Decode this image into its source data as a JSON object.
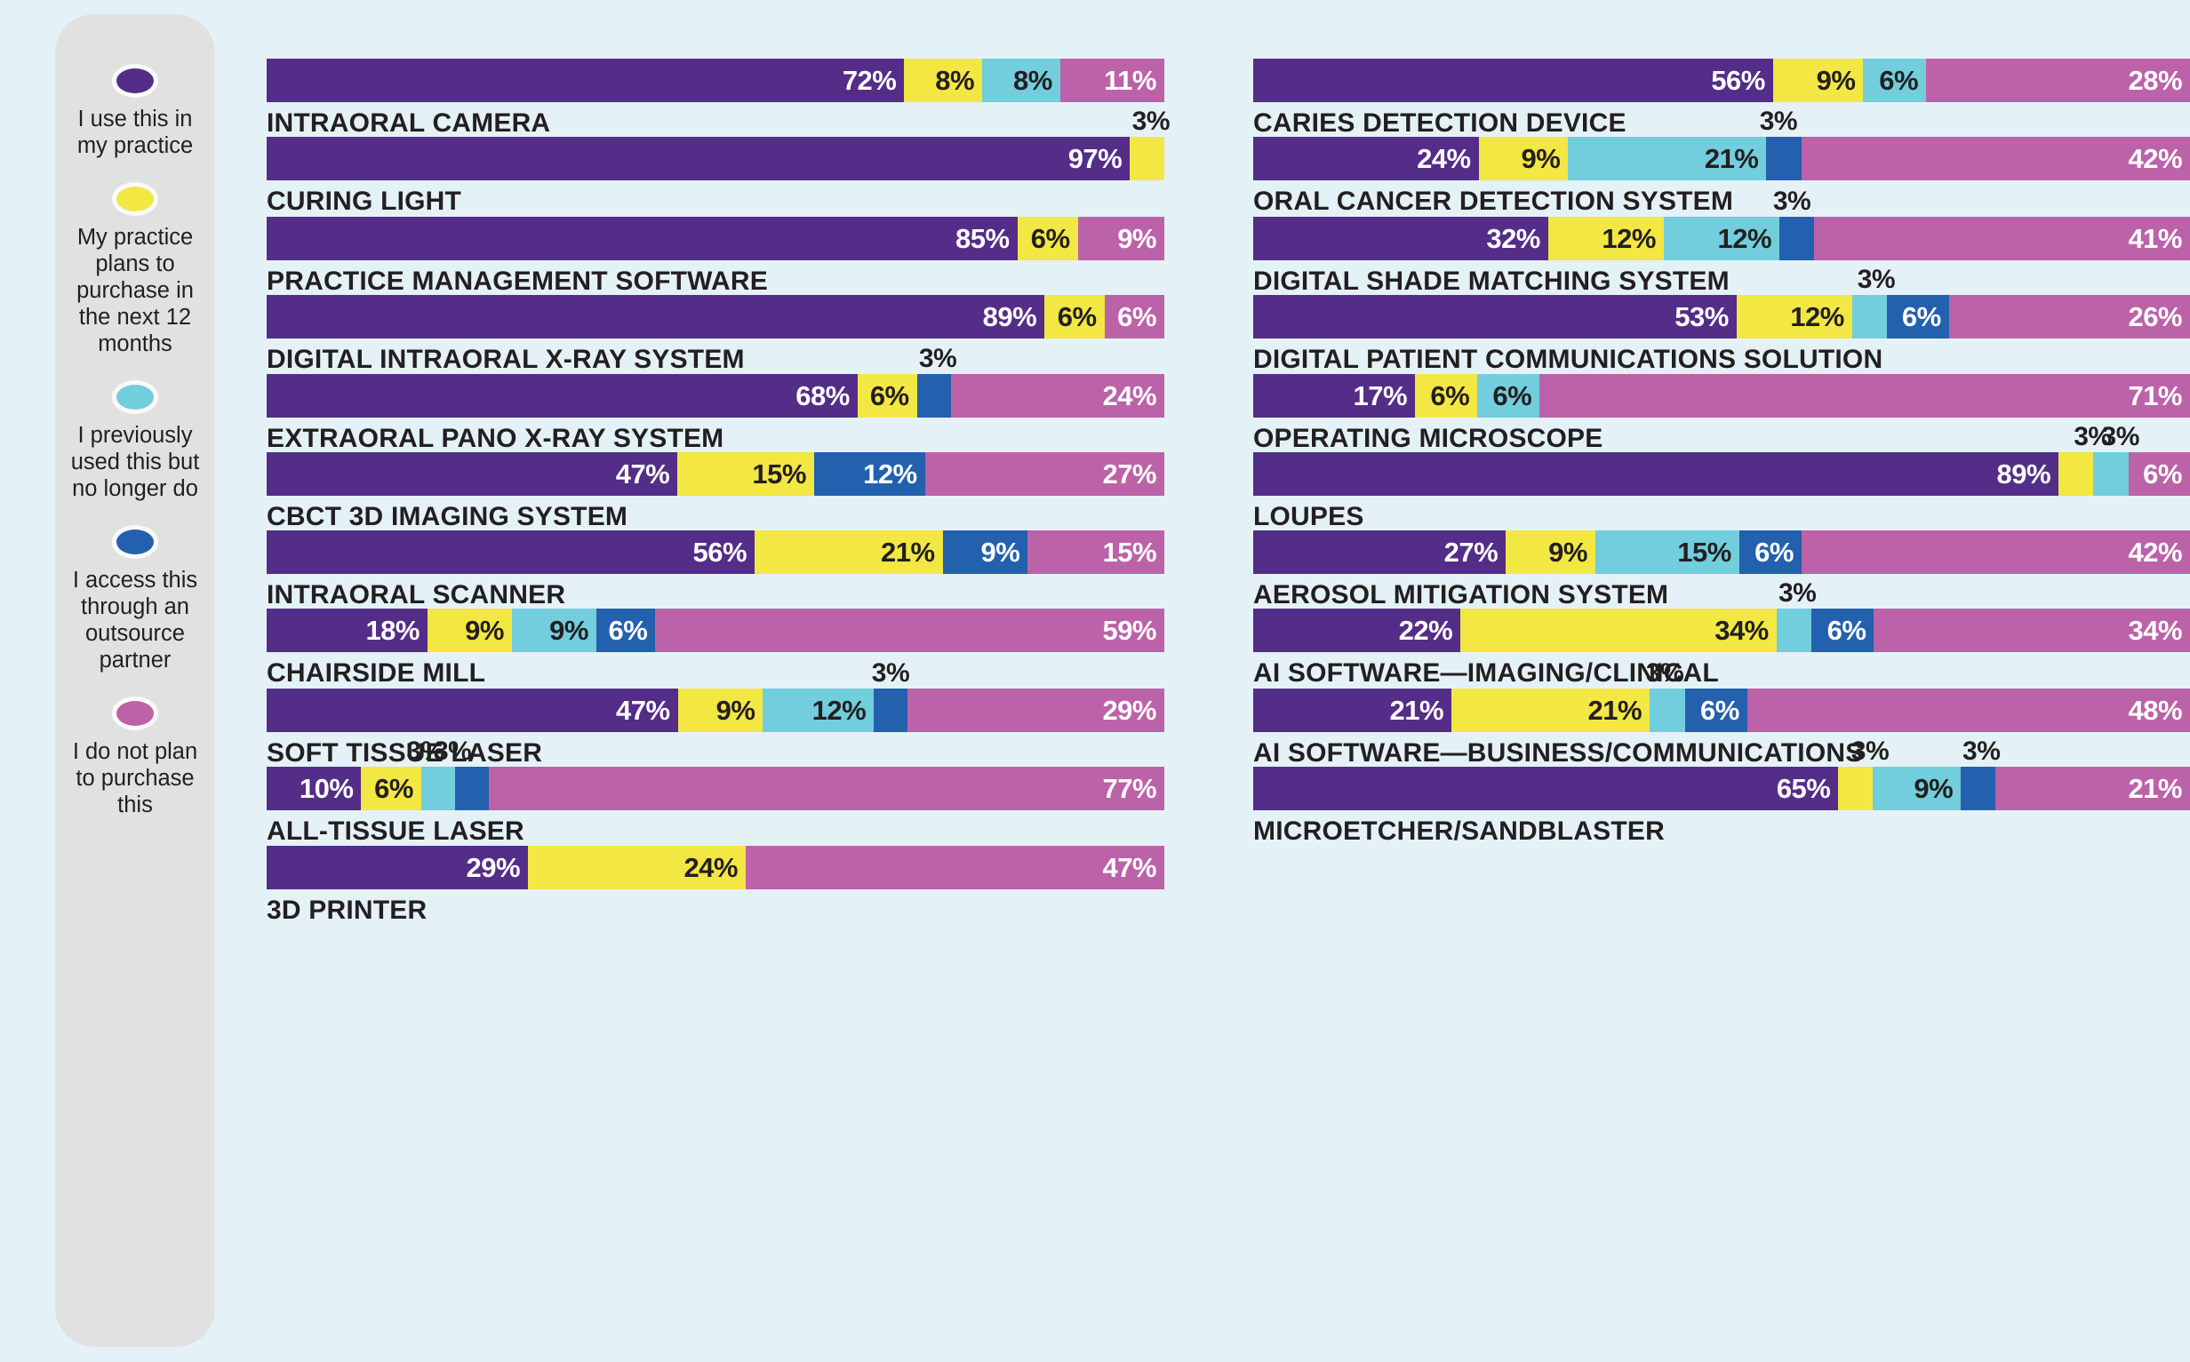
{
  "background_color": "#e4f2f7",
  "legend": {
    "panel_color": "#e2e1e1",
    "items": [
      {
        "color": "#532d87",
        "label": "I use this in my practice"
      },
      {
        "color": "#f3e743",
        "label": "My practice plans to purchase in the next 12 months"
      },
      {
        "color": "#72cddc",
        "label": "I previously used this but no longer do"
      },
      {
        "color": "#2360ae",
        "label": "I access this through an outsource partner"
      },
      {
        "color": "#bc62a8",
        "label": "I do not plan to purchase this"
      }
    ]
  },
  "chart_data": {
    "type": "bar",
    "title": "",
    "xlabel": "",
    "ylabel": "",
    "orientation": "horizontal",
    "stacked": true,
    "normalized_percent": true,
    "xlim": [
      0,
      100
    ],
    "grid": false,
    "legend_position": "left",
    "series": [
      {
        "name": "I use this in my practice",
        "color": "#532d87"
      },
      {
        "name": "My practice plans to purchase in the next 12 months",
        "color": "#f3e743"
      },
      {
        "name": "I previously used this but no longer do",
        "color": "#72cddc"
      },
      {
        "name": "I access this through an outsource partner",
        "color": "#2360ae"
      },
      {
        "name": "I do not plan to purchase this",
        "color": "#bc62a8"
      }
    ],
    "columns": [
      {
        "id": "left",
        "categories": [
          {
            "label": "INTRAORAL CAMERA",
            "segments": [
              {
                "series": 0,
                "value": 72,
                "label": "72%",
                "inside": true
              },
              {
                "series": 1,
                "value": 8,
                "label": "8%",
                "inside": true
              },
              {
                "series": 2,
                "value": 8,
                "label": "8%",
                "inside": true
              },
              {
                "series": 4,
                "value": 11,
                "label": "11%",
                "inside": true
              }
            ]
          },
          {
            "label": "CURING LIGHT",
            "segments": [
              {
                "series": 0,
                "value": 97,
                "label": "97%",
                "inside": true
              },
              {
                "series": 1,
                "value": 3,
                "label": "3%",
                "inside": false
              }
            ]
          },
          {
            "label": "PRACTICE MANAGEMENT SOFTWARE",
            "segments": [
              {
                "series": 0,
                "value": 85,
                "label": "85%",
                "inside": true
              },
              {
                "series": 1,
                "value": 6,
                "label": "6%",
                "inside": true
              },
              {
                "series": 4,
                "value": 9,
                "label": "9%",
                "inside": true
              }
            ]
          },
          {
            "label": "DIGITAL INTRAORAL X-RAY SYSTEM",
            "segments": [
              {
                "series": 0,
                "value": 89,
                "label": "89%",
                "inside": true
              },
              {
                "series": 1,
                "value": 6,
                "label": "6%",
                "inside": true
              },
              {
                "series": 4,
                "value": 6,
                "label": "6%",
                "inside": true
              }
            ]
          },
          {
            "label": "EXTRAORAL PANO X-RAY SYSTEM",
            "segments": [
              {
                "series": 0,
                "value": 68,
                "label": "68%",
                "inside": true
              },
              {
                "series": 1,
                "value": 6,
                "label": "6%",
                "inside": true
              },
              {
                "series": 3,
                "value": 3,
                "label": "3%",
                "inside": false
              },
              {
                "series": 4,
                "value": 24,
                "label": "24%",
                "inside": true
              }
            ]
          },
          {
            "label": "CBCT 3D IMAGING SYSTEM",
            "segments": [
              {
                "series": 0,
                "value": 47,
                "label": "47%",
                "inside": true
              },
              {
                "series": 1,
                "value": 15,
                "label": "15%",
                "inside": true
              },
              {
                "series": 3,
                "value": 12,
                "label": "12%",
                "inside": true
              },
              {
                "series": 4,
                "value": 27,
                "label": "27%",
                "inside": true
              }
            ]
          },
          {
            "label": "INTRAORAL SCANNER",
            "segments": [
              {
                "series": 0,
                "value": 56,
                "label": "56%",
                "inside": true
              },
              {
                "series": 1,
                "value": 21,
                "label": "21%",
                "inside": true
              },
              {
                "series": 3,
                "value": 9,
                "label": "9%",
                "inside": true
              },
              {
                "series": 4,
                "value": 15,
                "label": "15%",
                "inside": true
              }
            ]
          },
          {
            "label": "CHAIRSIDE MILL",
            "segments": [
              {
                "series": 0,
                "value": 18,
                "label": "18%",
                "inside": true
              },
              {
                "series": 1,
                "value": 9,
                "label": "9%",
                "inside": true
              },
              {
                "series": 2,
                "value": 9,
                "label": "9%",
                "inside": true
              },
              {
                "series": 3,
                "value": 6,
                "label": "6%",
                "inside": true
              },
              {
                "series": 4,
                "value": 59,
                "label": "59%",
                "inside": true
              }
            ]
          },
          {
            "label": "SOFT TISSUE LASER",
            "segments": [
              {
                "series": 0,
                "value": 47,
                "label": "47%",
                "inside": true
              },
              {
                "series": 1,
                "value": 9,
                "label": "9%",
                "inside": true
              },
              {
                "series": 2,
                "value": 12,
                "label": "12%",
                "inside": true
              },
              {
                "series": 3,
                "value": 3,
                "label": "3%",
                "inside": false
              },
              {
                "series": 4,
                "value": 29,
                "label": "29%",
                "inside": true
              }
            ]
          },
          {
            "label": "ALL-TISSUE LASER",
            "segments": [
              {
                "series": 0,
                "value": 10,
                "label": "10%",
                "inside": true
              },
              {
                "series": 1,
                "value": 6,
                "label": "6%",
                "inside": true
              },
              {
                "series": 2,
                "value": 3,
                "label": "3%",
                "inside": false
              },
              {
                "series": 3,
                "value": 3,
                "label": "3%",
                "inside": false
              },
              {
                "series": 4,
                "value": 77,
                "label": "77%",
                "inside": true
              }
            ]
          },
          {
            "label": "3D PRINTER",
            "segments": [
              {
                "series": 0,
                "value": 29,
                "label": "29%",
                "inside": true
              },
              {
                "series": 1,
                "value": 24,
                "label": "24%",
                "inside": true
              },
              {
                "series": 4,
                "value": 47,
                "label": "47%",
                "inside": true
              }
            ]
          }
        ]
      },
      {
        "id": "right",
        "categories": [
          {
            "label": "CARIES DETECTION DEVICE",
            "segments": [
              {
                "series": 0,
                "value": 56,
                "label": "56%",
                "inside": true
              },
              {
                "series": 1,
                "value": 9,
                "label": "9%",
                "inside": true
              },
              {
                "series": 2,
                "value": 6,
                "label": "6%",
                "inside": true
              },
              {
                "series": 4,
                "value": 28,
                "label": "28%",
                "inside": true
              }
            ]
          },
          {
            "label": "ORAL CANCER DETECTION SYSTEM",
            "segments": [
              {
                "series": 0,
                "value": 24,
                "label": "24%",
                "inside": true
              },
              {
                "series": 1,
                "value": 9,
                "label": "9%",
                "inside": true
              },
              {
                "series": 2,
                "value": 21,
                "label": "21%",
                "inside": true
              },
              {
                "series": 3,
                "value": 3,
                "label": "3%",
                "inside": false
              },
              {
                "series": 4,
                "value": 42,
                "label": "42%",
                "inside": true
              }
            ]
          },
          {
            "label": "DIGITAL SHADE MATCHING SYSTEM",
            "segments": [
              {
                "series": 0,
                "value": 32,
                "label": "32%",
                "inside": true
              },
              {
                "series": 1,
                "value": 12,
                "label": "12%",
                "inside": true
              },
              {
                "series": 2,
                "value": 12,
                "label": "12%",
                "inside": true
              },
              {
                "series": 3,
                "value": 3,
                "label": "3%",
                "inside": false
              },
              {
                "series": 4,
                "value": 41,
                "label": "41%",
                "inside": true
              }
            ]
          },
          {
            "label": "DIGITAL PATIENT COMMUNICATIONS SOLUTION",
            "segments": [
              {
                "series": 0,
                "value": 53,
                "label": "53%",
                "inside": true
              },
              {
                "series": 1,
                "value": 12,
                "label": "12%",
                "inside": true
              },
              {
                "series": 2,
                "value": 3,
                "label": "3%",
                "inside": false
              },
              {
                "series": 3,
                "value": 6,
                "label": "6%",
                "inside": true
              },
              {
                "series": 4,
                "value": 26,
                "label": "26%",
                "inside": true
              }
            ]
          },
          {
            "label": "OPERATING MICROSCOPE",
            "segments": [
              {
                "series": 0,
                "value": 17,
                "label": "17%",
                "inside": true
              },
              {
                "series": 1,
                "value": 6,
                "label": "6%",
                "inside": true
              },
              {
                "series": 2,
                "value": 6,
                "label": "6%",
                "inside": true
              },
              {
                "series": 4,
                "value": 71,
                "label": "71%",
                "inside": true
              }
            ]
          },
          {
            "label": "LOUPES",
            "segments": [
              {
                "series": 0,
                "value": 89,
                "label": "89%",
                "inside": true
              },
              {
                "series": 1,
                "value": 3,
                "label": "3%",
                "inside": false
              },
              {
                "series": 2,
                "value": 3,
                "label": "3%",
                "inside": false
              },
              {
                "series": 4,
                "value": 6,
                "label": "6%",
                "inside": true
              }
            ]
          },
          {
            "label": "AEROSOL MITIGATION SYSTEM",
            "segments": [
              {
                "series": 0,
                "value": 27,
                "label": "27%",
                "inside": true
              },
              {
                "series": 1,
                "value": 9,
                "label": "9%",
                "inside": true
              },
              {
                "series": 2,
                "value": 15,
                "label": "15%",
                "inside": true
              },
              {
                "series": 3,
                "value": 6,
                "label": "6%",
                "inside": true
              },
              {
                "series": 4,
                "value": 42,
                "label": "42%",
                "inside": true
              }
            ]
          },
          {
            "label": "AI SOFTWARE—IMAGING/CLINICAL",
            "segments": [
              {
                "series": 0,
                "value": 22,
                "label": "22%",
                "inside": true
              },
              {
                "series": 1,
                "value": 34,
                "label": "34%",
                "inside": true
              },
              {
                "series": 2,
                "value": 3,
                "label": "3%",
                "inside": false
              },
              {
                "series": 3,
                "value": 6,
                "label": "6%",
                "inside": true
              },
              {
                "series": 4,
                "value": 34,
                "label": "34%",
                "inside": true
              }
            ]
          },
          {
            "label": "AI SOFTWARE—BUSINESS/COMMUNICATIONS",
            "segments": [
              {
                "series": 0,
                "value": 21,
                "label": "21%",
                "inside": true
              },
              {
                "series": 1,
                "value": 21,
                "label": "21%",
                "inside": true
              },
              {
                "series": 2,
                "value": 3,
                "label": "3%",
                "inside": false
              },
              {
                "series": 3,
                "value": 6,
                "label": "6%",
                "inside": true
              },
              {
                "series": 4,
                "value": 48,
                "label": "48%",
                "inside": true
              }
            ]
          },
          {
            "label": "MICROETCHER/SANDBLASTER",
            "segments": [
              {
                "series": 0,
                "value": 65,
                "label": "65%",
                "inside": true
              },
              {
                "series": 1,
                "value": 3,
                "label": "3%",
                "inside": false
              },
              {
                "series": 2,
                "value": 9,
                "label": "9%",
                "inside": true
              },
              {
                "series": 3,
                "value": 3,
                "label": "3%",
                "inside": false
              },
              {
                "series": 4,
                "value": 21,
                "label": "21%",
                "inside": true
              }
            ]
          }
        ]
      }
    ]
  }
}
